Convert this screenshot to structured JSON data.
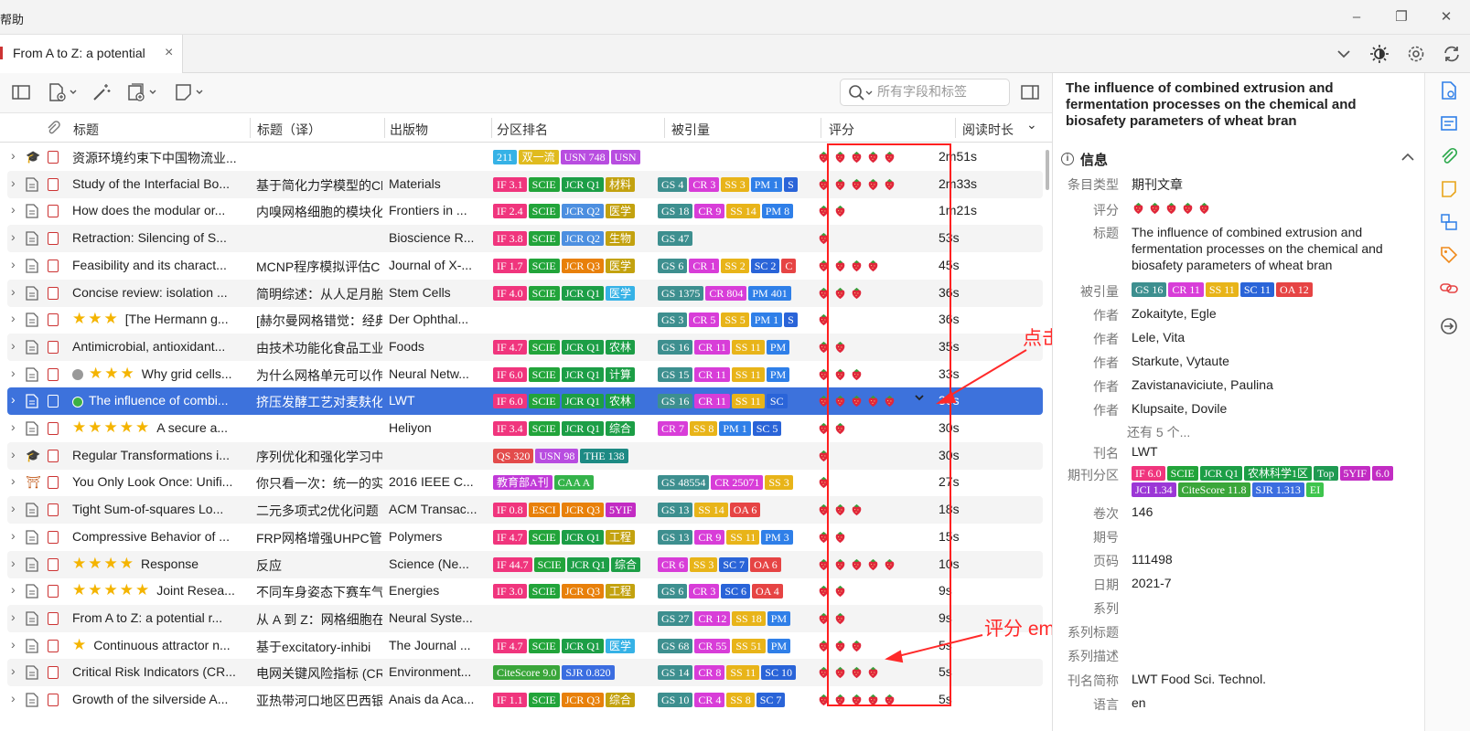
{
  "menu": {
    "help": "帮助"
  },
  "tab": {
    "title": "From A to Z: a potential",
    "close": "×"
  },
  "search": {
    "placeholder": "所有字段和标签"
  },
  "columns": {
    "title": "标题",
    "title_tr": "标题（译）",
    "pub": "出版物",
    "rank": "分区排名",
    "cited": "被引量",
    "rating": "评分",
    "read": "阅读时长",
    "read_sort": "⌄"
  },
  "colors": {
    "IF": "#f0357d",
    "SCIE": "#22a43a",
    "JCRQ1": "#1c9e46",
    "JCRQ2": "#4c8fe0",
    "JCRQ3": "#e4850f",
    "field": "#c3a20f",
    "GS": "#3d8f8f",
    "CR": "#d83dd8",
    "SS": "#e8b419",
    "PM": "#2f7fe8",
    "SC": "#2a64d8",
    "OA": "#e64444",
    "b211": "#36b2e6",
    "double": "#e0bb1f",
    "USN": "#b84de0",
    "QS": "#e34b4b",
    "THE": "#1d8a84",
    "EDU": "#c13ad8",
    "CAA": "#34b34a",
    "ESCI": "#e8800a",
    "YIF": "#c22cc3",
    "CiteScore": "#3aa63a",
    "SJR": "#3b6de0",
    "JCI": "#9b37d6",
    "Top": "#1f9a52",
    "EI": "#3ec44d",
    "selected": "#3d72dc",
    "annotation": "#ff2a2a"
  },
  "rows": [
    {
      "title": "资源环境约束下中国物流业...",
      "title_tr": "",
      "pub": "",
      "icon": "thesis",
      "badges": [
        [
          "211",
          "b211"
        ],
        [
          "双一流",
          "double"
        ],
        [
          "USN 748",
          "USN"
        ],
        [
          "USN",
          "USN"
        ]
      ],
      "cited": [],
      "rating": 5,
      "read": "2m51s"
    },
    {
      "title": "Study of the Interfacial Bo...",
      "title_tr": "基于简化力学模型的Cl",
      "pub": "Materials",
      "icon": "doc",
      "badges": [
        [
          "IF 3.1",
          "IF"
        ],
        [
          "SCIE",
          "SCIE"
        ],
        [
          "JCR Q1",
          "JCRQ1"
        ],
        [
          "材料",
          "field"
        ]
      ],
      "cited": [
        [
          "GS 4",
          "GS"
        ],
        [
          "CR 3",
          "CR"
        ],
        [
          "SS 3",
          "SS"
        ],
        [
          "PM 1",
          "PM"
        ],
        [
          "S",
          "SC"
        ]
      ],
      "rating": 5,
      "read": "2m33s"
    },
    {
      "title": "How does the modular or...",
      "title_tr": "内嗅网格细胞的模块化",
      "pub": "Frontiers in ...",
      "icon": "doc",
      "badges": [
        [
          "IF 2.4",
          "IF"
        ],
        [
          "SCIE",
          "SCIE"
        ],
        [
          "JCR Q2",
          "JCRQ2"
        ],
        [
          "医学",
          "field"
        ]
      ],
      "cited": [
        [
          "GS 18",
          "GS"
        ],
        [
          "CR 9",
          "CR"
        ],
        [
          "SS 14",
          "SS"
        ],
        [
          "PM 8",
          "PM"
        ]
      ],
      "rating": 2,
      "read": "1m21s"
    },
    {
      "title": "Retraction: Silencing of S...",
      "title_tr": "",
      "pub": "Bioscience R...",
      "icon": "doc",
      "badges": [
        [
          "IF 3.8",
          "IF"
        ],
        [
          "SCIE",
          "SCIE"
        ],
        [
          "JCR Q2",
          "JCRQ2"
        ],
        [
          "生物",
          "field"
        ]
      ],
      "cited": [
        [
          "GS 47",
          "GS"
        ]
      ],
      "rating": 1,
      "read": "53s"
    },
    {
      "title": "Feasibility and its charact...",
      "title_tr": "MCNP程序模拟评估C",
      "pub": "Journal of X-...",
      "icon": "doc",
      "badges": [
        [
          "IF 1.7",
          "IF"
        ],
        [
          "SCIE",
          "SCIE"
        ],
        [
          "JCR Q3",
          "ESCI"
        ],
        [
          "医学",
          "field"
        ]
      ],
      "cited": [
        [
          "GS 6",
          "GS"
        ],
        [
          "CR 1",
          "CR"
        ],
        [
          "SS 2",
          "SS"
        ],
        [
          "SC 2",
          "SC"
        ],
        [
          "C",
          "OA"
        ]
      ],
      "rating": 4,
      "read": "45s"
    },
    {
      "title": "Concise review: isolation ...",
      "title_tr": "简明综述：从人足月胎",
      "pub": "Stem Cells",
      "icon": "doc",
      "badges": [
        [
          "IF 4.0",
          "IF"
        ],
        [
          "SCIE",
          "SCIE"
        ],
        [
          "JCR Q1",
          "JCRQ1"
        ],
        [
          "医学",
          "b211"
        ]
      ],
      "cited": [
        [
          "GS 1375",
          "GS"
        ],
        [
          "CR 804",
          "CR"
        ],
        [
          "PM 401",
          "PM"
        ]
      ],
      "rating": 3,
      "read": "36s"
    },
    {
      "title": "[The Hermann g...",
      "title_tr": "[赫尔曼网格错觉：经典",
      "pub": "Der Ophthal...",
      "icon": "doc",
      "stars": 3,
      "badges": [],
      "cited": [
        [
          "GS 3",
          "GS"
        ],
        [
          "CR 5",
          "CR"
        ],
        [
          "SS 5",
          "SS"
        ],
        [
          "PM 1",
          "PM"
        ],
        [
          "S",
          "SC"
        ]
      ],
      "rating": 1,
      "read": "36s"
    },
    {
      "title": "Antimicrobial, antioxidant...",
      "title_tr": "由技术功能化食品工业",
      "pub": "Foods",
      "icon": "doc",
      "badges": [
        [
          "IF 4.7",
          "IF"
        ],
        [
          "SCIE",
          "SCIE"
        ],
        [
          "JCR Q1",
          "JCRQ1"
        ],
        [
          "农林",
          "JCRQ1"
        ]
      ],
      "cited": [
        [
          "GS 16",
          "GS"
        ],
        [
          "CR 11",
          "CR"
        ],
        [
          "SS 11",
          "SS"
        ],
        [
          "PM",
          "PM"
        ]
      ],
      "rating": 2,
      "read": "35s"
    },
    {
      "title": "Why grid cells...",
      "title_tr": "为什么网格单元可以作",
      "pub": "Neural Netw...",
      "icon": "doc",
      "dot": "gray",
      "stars": 3,
      "badges": [
        [
          "IF 6.0",
          "IF"
        ],
        [
          "SCIE",
          "SCIE"
        ],
        [
          "JCR Q1",
          "JCRQ1"
        ],
        [
          "计算",
          "JCRQ1"
        ]
      ],
      "cited": [
        [
          "GS 15",
          "GS"
        ],
        [
          "CR 11",
          "CR"
        ],
        [
          "SS 11",
          "SS"
        ],
        [
          "PM",
          "PM"
        ]
      ],
      "rating": 3,
      "read": "33s"
    },
    {
      "title": "The influence of combi...",
      "title_tr": "挤压发酵工艺对麦麸化",
      "pub": "LWT",
      "icon": "doc",
      "dot": "green",
      "badges": [
        [
          "IF 6.0",
          "IF"
        ],
        [
          "SCIE",
          "SCIE"
        ],
        [
          "JCR Q1",
          "JCRQ1"
        ],
        [
          "农林",
          "JCRQ1"
        ]
      ],
      "cited": [
        [
          "GS 16",
          "GS"
        ],
        [
          "CR 11",
          "CR"
        ],
        [
          "SS 11",
          "SS"
        ],
        [
          "SC",
          "SC"
        ]
      ],
      "rating": 5,
      "read": "30s",
      "selected": true
    },
    {
      "title": "A secure a...",
      "title_tr": "",
      "pub": "Heliyon",
      "icon": "doc",
      "stars": 5,
      "badges": [
        [
          "IF 3.4",
          "IF"
        ],
        [
          "SCIE",
          "SCIE"
        ],
        [
          "JCR Q1",
          "JCRQ1"
        ],
        [
          "综合",
          "JCRQ1"
        ]
      ],
      "cited": [
        [
          "CR 7",
          "CR"
        ],
        [
          "SS 8",
          "SS"
        ],
        [
          "PM 1",
          "PM"
        ],
        [
          "SC 5",
          "SC"
        ]
      ],
      "rating": 2,
      "read": "30s"
    },
    {
      "title": "Regular Transformations i...",
      "title_tr": "序列优化和强化学习中",
      "pub": "",
      "icon": "thesis",
      "badges": [
        [
          "QS 320",
          "QS"
        ],
        [
          "USN 98",
          "USN"
        ],
        [
          "THE 138",
          "THE"
        ]
      ],
      "cited": [],
      "rating": 1,
      "read": "30s"
    },
    {
      "title": "You Only Look Once: Unifi...",
      "title_tr": "你只看一次：统一的实",
      "pub": "2016 IEEE C...",
      "icon": "conf",
      "badges": [
        [
          "教育部A刊",
          "EDU"
        ],
        [
          "CAA A",
          "CAA"
        ]
      ],
      "cited": [
        [
          "GS 48554",
          "GS"
        ],
        [
          "CR 25071",
          "CR"
        ],
        [
          "SS 3",
          "SS"
        ]
      ],
      "rating": 1,
      "read": "27s"
    },
    {
      "title": "Tight Sum-of-squares Lo...",
      "title_tr": "二元多项式2优化问题",
      "pub": "ACM Transac...",
      "icon": "doc",
      "badges": [
        [
          "IF 0.8",
          "IF"
        ],
        [
          "ESCI",
          "ESCI"
        ],
        [
          "JCR Q3",
          "ESCI"
        ],
        [
          "5YIF",
          "YIF"
        ]
      ],
      "cited": [
        [
          "GS 13",
          "GS"
        ],
        [
          "SS 14",
          "SS"
        ],
        [
          "OA 6",
          "OA"
        ]
      ],
      "rating": 3,
      "read": "18s"
    },
    {
      "title": "Compressive Behavior of ...",
      "title_tr": "FRP网格增强UHPC管",
      "pub": "Polymers",
      "icon": "doc",
      "badges": [
        [
          "IF 4.7",
          "IF"
        ],
        [
          "SCIE",
          "SCIE"
        ],
        [
          "JCR Q1",
          "JCRQ1"
        ],
        [
          "工程",
          "field"
        ]
      ],
      "cited": [
        [
          "GS 13",
          "GS"
        ],
        [
          "CR 9",
          "CR"
        ],
        [
          "SS 11",
          "SS"
        ],
        [
          "PM 3",
          "PM"
        ]
      ],
      "rating": 2,
      "read": "15s"
    },
    {
      "title": "Response",
      "title_tr": "反应",
      "pub": "Science (Ne...",
      "icon": "doc",
      "stars": 4,
      "badges": [
        [
          "IF 44.7",
          "IF"
        ],
        [
          "SCIE",
          "SCIE"
        ],
        [
          "JCR Q1",
          "JCRQ1"
        ],
        [
          "综合",
          "JCRQ1"
        ]
      ],
      "cited": [
        [
          "CR 6",
          "CR"
        ],
        [
          "SS 3",
          "SS"
        ],
        [
          "SC 7",
          "SC"
        ],
        [
          "OA 6",
          "OA"
        ]
      ],
      "rating": 5,
      "read": "10s"
    },
    {
      "title": "Joint Resea...",
      "title_tr": "不同车身姿态下赛车气",
      "pub": "Energies",
      "icon": "doc",
      "stars": 5,
      "badges": [
        [
          "IF 3.0",
          "IF"
        ],
        [
          "SCIE",
          "SCIE"
        ],
        [
          "JCR Q3",
          "ESCI"
        ],
        [
          "工程",
          "field"
        ]
      ],
      "cited": [
        [
          "GS 6",
          "GS"
        ],
        [
          "CR 3",
          "CR"
        ],
        [
          "SC 6",
          "SC"
        ],
        [
          "OA 4",
          "OA"
        ]
      ],
      "rating": 2,
      "read": "9s"
    },
    {
      "title": "From A to Z: a potential r...",
      "title_tr": "从 A 到 Z：网格细胞在",
      "pub": "Neural Syste...",
      "icon": "doc",
      "badges": [],
      "cited": [
        [
          "GS 27",
          "GS"
        ],
        [
          "CR 12",
          "CR"
        ],
        [
          "SS 18",
          "SS"
        ],
        [
          "PM",
          "PM"
        ]
      ],
      "rating": 2,
      "read": "9s"
    },
    {
      "title": "Continuous attractor n...",
      "title_tr": "基于excitatory-inhibi",
      "pub": "The Journal ...",
      "icon": "doc",
      "stars": 1,
      "badges": [
        [
          "IF 4.7",
          "IF"
        ],
        [
          "SCIE",
          "SCIE"
        ],
        [
          "JCR Q1",
          "JCRQ1"
        ],
        [
          "医学",
          "b211"
        ]
      ],
      "cited": [
        [
          "GS 68",
          "GS"
        ],
        [
          "CR 55",
          "CR"
        ],
        [
          "SS 51",
          "SS"
        ],
        [
          "PM",
          "PM"
        ]
      ],
      "rating": 3,
      "read": "5s"
    },
    {
      "title": "Critical Risk Indicators (CR...",
      "title_tr": "电网关键风险指标 (CR",
      "pub": "Environment...",
      "icon": "doc",
      "badges": [
        [
          "CiteScore 9.0",
          "CiteScore"
        ],
        [
          "SJR 0.820",
          "SJR"
        ]
      ],
      "cited": [
        [
          "GS 14",
          "GS"
        ],
        [
          "CR 8",
          "CR"
        ],
        [
          "SS 11",
          "SS"
        ],
        [
          "SC 10",
          "SC"
        ]
      ],
      "rating": 4,
      "read": "5s"
    },
    {
      "title": "Growth of the silverside A...",
      "title_tr": "亚热带河口地区巴西银",
      "pub": "Anais da Aca...",
      "icon": "doc",
      "badges": [
        [
          "IF 1.1",
          "IF"
        ],
        [
          "SCIE",
          "SCIE"
        ],
        [
          "JCR Q3",
          "ESCI"
        ],
        [
          "综合",
          "field"
        ]
      ],
      "cited": [
        [
          "GS 10",
          "GS"
        ],
        [
          "CR 4",
          "CR"
        ],
        [
          "SS 8",
          "SS"
        ],
        [
          "SC 7",
          "SC"
        ]
      ],
      "rating": 5,
      "read": "5s"
    }
  ],
  "panel": {
    "title": "The influence of combined extrusion and fermentation processes on the chemical and biosafety parameters of wheat bran",
    "info": "信息",
    "item_type_label": "条目类型",
    "item_type": "期刊文章",
    "rating_label": "评分",
    "rating": 5,
    "title_label": "标题",
    "title_val": "The influence of combined extrusion and fermentation processes on the chemical and biosafety parameters of wheat bran",
    "cited_label": "被引量",
    "cited": [
      [
        "GS 16",
        "GS"
      ],
      [
        "CR 11",
        "CR"
      ],
      [
        "SS 11",
        "SS"
      ],
      [
        "SC 11",
        "SC"
      ],
      [
        "OA 12",
        "OA"
      ]
    ],
    "author_label": "作者",
    "authors": [
      "Zokaityte, Egle",
      "Lele, Vita",
      "Starkute, Vytaute",
      "Zavistanaviciute, Paulina",
      "Klupsaite, Dovile"
    ],
    "more_authors": "还有 5 个...",
    "journal_label": "刊名",
    "journal": "LWT",
    "jrank_label": "期刊分区",
    "jrank": [
      [
        "IF 6.0",
        "IF"
      ],
      [
        "SCIE",
        "SCIE"
      ],
      [
        "JCR Q1",
        "JCRQ1"
      ],
      [
        "农林科学1区",
        "JCRQ1"
      ],
      [
        "Top",
        "Top"
      ],
      [
        "5YIF",
        "YIF"
      ],
      [
        "6.0",
        "YIF"
      ],
      [
        "JCI 1.34",
        "JCI"
      ],
      [
        "CiteScore 11.8",
        "CiteScore"
      ],
      [
        "SJR 1.313",
        "SJR"
      ],
      [
        "EI",
        "EI"
      ]
    ],
    "volume_label": "卷次",
    "volume": "146",
    "issue_label": "期号",
    "pages_label": "页码",
    "pages": "111498",
    "date_label": "日期",
    "date": "2021-7",
    "series_label": "系列",
    "series_title_label": "系列标题",
    "series_desc_label": "系列描述",
    "abbr_label": "刊名简称",
    "abbr": "LWT Food Sci. Technol.",
    "lang_label": "语言",
    "lang": "en"
  },
  "annotations": {
    "click_icon": "点击这个图标，可以修改评分",
    "emoji": "评分 emoji，可以在设置中自定义修改"
  }
}
